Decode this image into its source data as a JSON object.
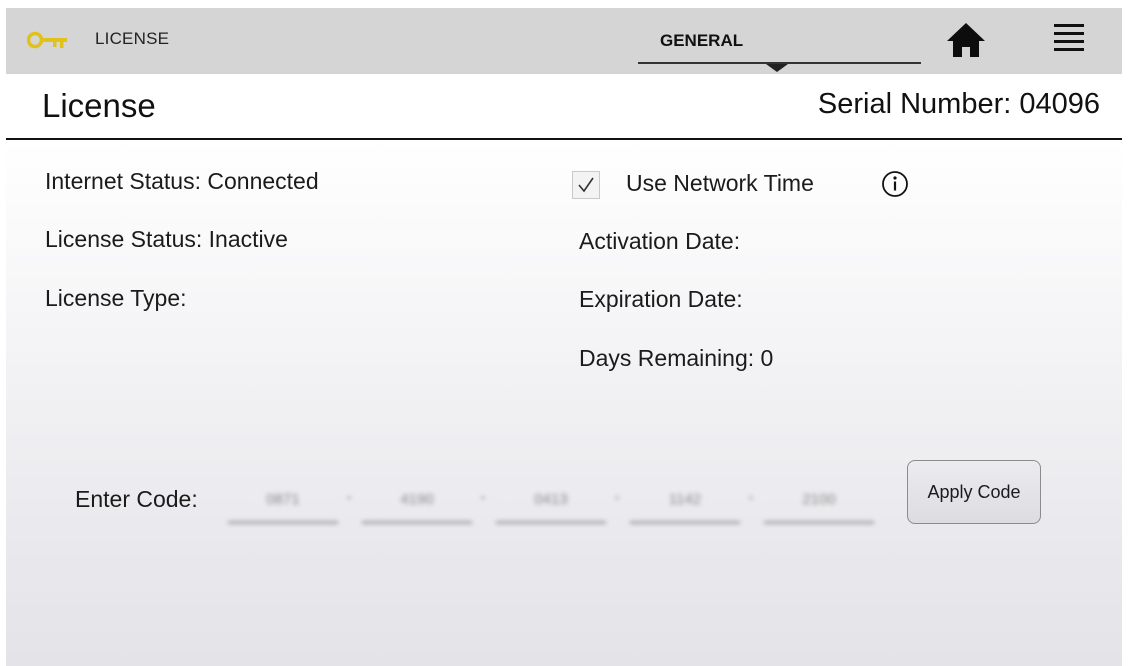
{
  "topbar": {
    "section_label": "LICENSE",
    "key_icon": "key-icon",
    "key_color": "#e0c21a",
    "tab_label": "GENERAL",
    "home_icon": "home-icon",
    "menu_icon": "hamburger-menu-icon"
  },
  "header": {
    "title": "License",
    "serial": "Serial Number:  04096"
  },
  "status": {
    "internet": "Internet Status: Connected",
    "license_status": "License Status: Inactive",
    "license_type": "License Type:",
    "use_network_time_checked": true,
    "use_network_time_label": "Use Network Time",
    "info_icon": "info-icon",
    "activation_date": "Activation Date:",
    "expiration_date": "Expiration Date:",
    "days_remaining": "Days Remaining: 0"
  },
  "code": {
    "label": "Enter Code:",
    "fields": [
      "0871",
      "4190",
      "0413",
      "1142",
      "2100"
    ],
    "separator": "•",
    "apply_label": "Apply Code"
  }
}
